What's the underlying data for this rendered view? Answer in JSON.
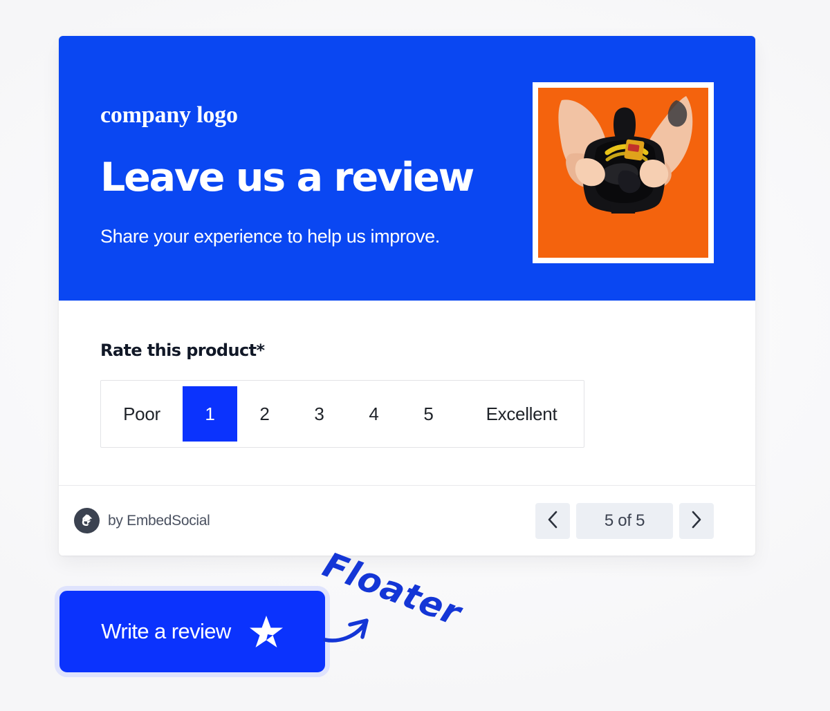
{
  "theme": {
    "brand_blue": "#0a47f2",
    "button_blue": "#0b33fd",
    "button_halo": "#dfe3fd",
    "page_background": "#fbfbfc",
    "image_background": "#f4630d",
    "footer_gray": "#eceff4",
    "brand_mark_gray": "#3b4250"
  },
  "header": {
    "company_logo": "company logo",
    "headline": "Leave us a review",
    "subhead": "Share your experience to help us improve.",
    "image_alt": "hands-holding-black-pouch-on-orange-background"
  },
  "body": {
    "field_label": "Rate this product*",
    "rating": {
      "low_label": "Poor",
      "high_label": "Excellent",
      "options": [
        "1",
        "2",
        "3",
        "4",
        "5"
      ],
      "selected": "1"
    }
  },
  "footer": {
    "brand_label": "by EmbedSocial",
    "brand_icon": "embedsocial-logo-icon",
    "pager": {
      "prev_icon": "chevron-left-icon",
      "next_icon": "chevron-right-icon",
      "count_label": "5 of 5",
      "current": 5,
      "total": 5
    }
  },
  "floater": {
    "button_label": "Write a review",
    "button_icon": "star-icon",
    "annotation_text": "Floater",
    "annotation_icon": "curved-arrow-icon"
  }
}
